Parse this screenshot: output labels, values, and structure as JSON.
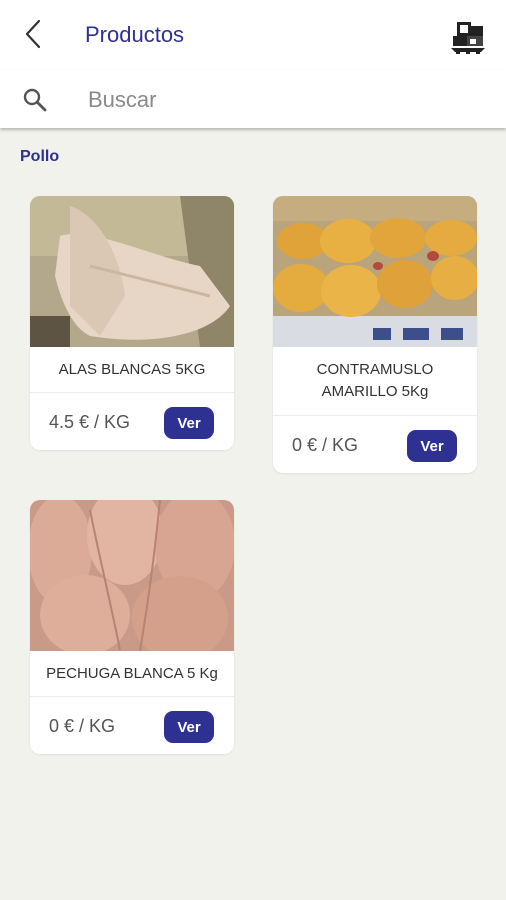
{
  "header": {
    "title": "Productos",
    "back_icon": "chevron-left-icon",
    "pallet_icon": "pallet-boxes-icon"
  },
  "search": {
    "placeholder": "Buscar",
    "value": "",
    "icon": "search-icon"
  },
  "category": "Pollo",
  "products": [
    {
      "name": "ALAS BLANCAS 5KG",
      "price": "4.5 € / KG",
      "button": "Ver"
    },
    {
      "name": "CONTRAMUSLO AMARILLO 5Kg",
      "price": "0 € / KG",
      "button": "Ver"
    },
    {
      "name": "PECHUGA BLANCA 5 Kg",
      "price": "0 € / KG",
      "button": "Ver"
    }
  ],
  "colors": {
    "accent": "#2e3192",
    "background": "#f2f2ed"
  }
}
